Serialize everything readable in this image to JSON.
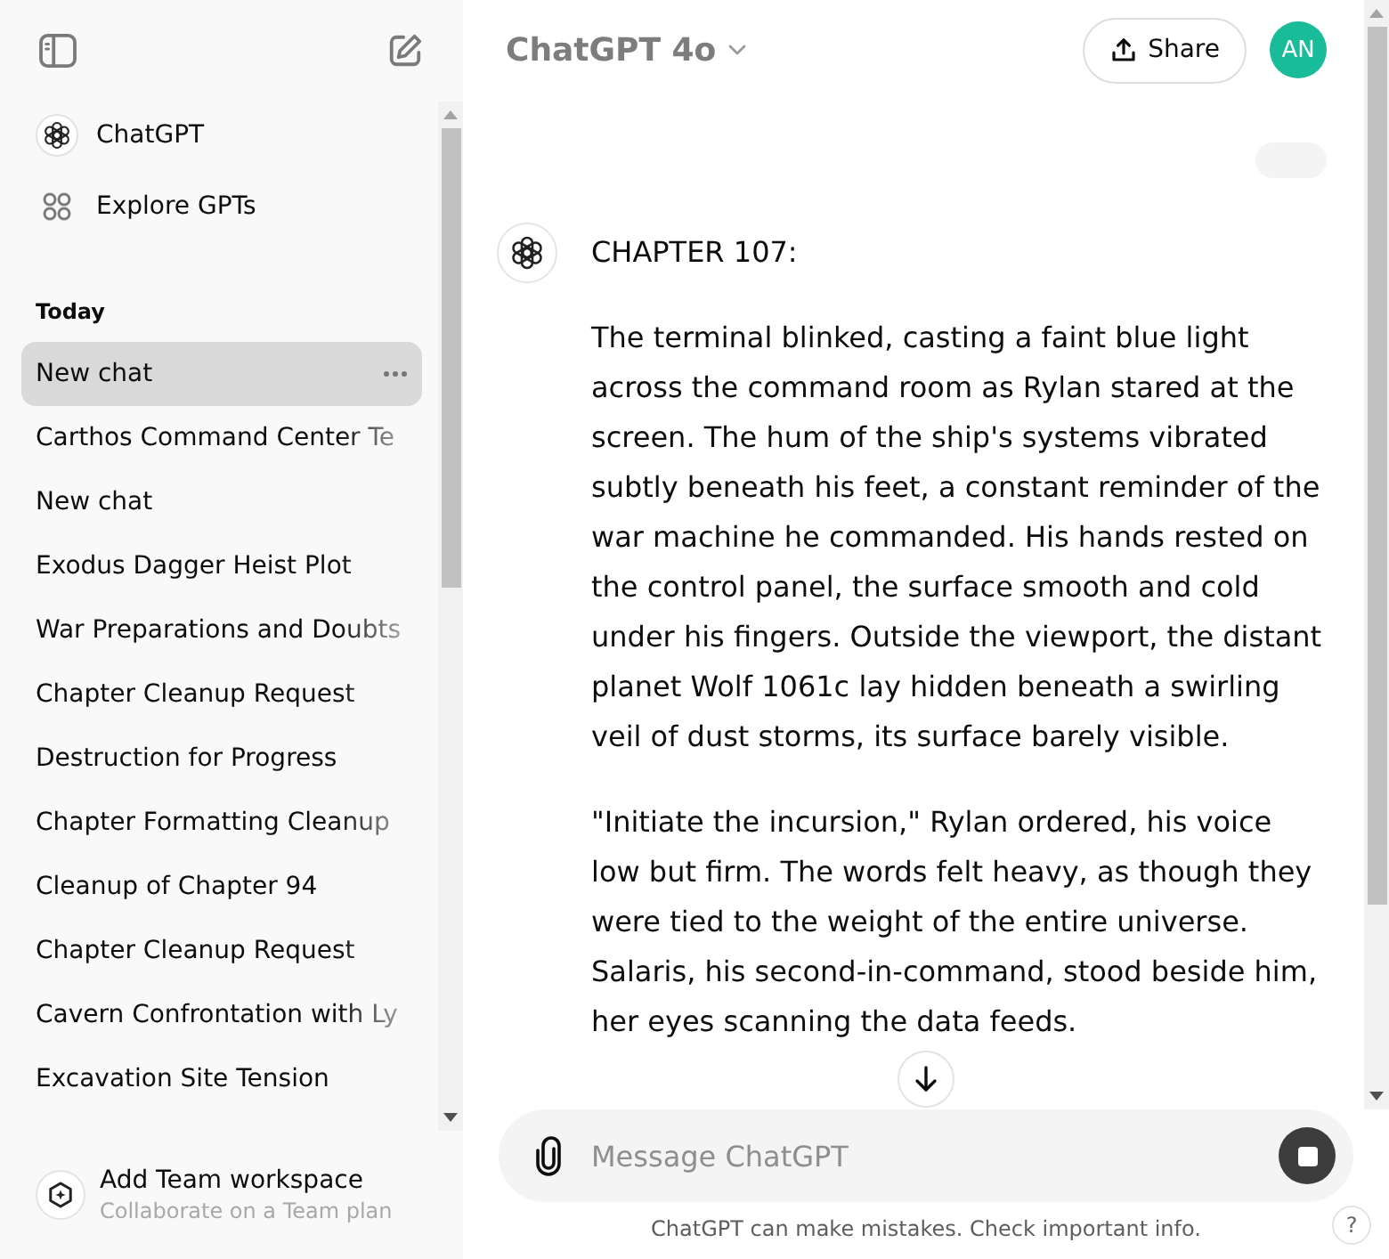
{
  "sidebar": {
    "nav": [
      {
        "kind": "chatgpt",
        "label": "ChatGPT"
      },
      {
        "kind": "explore",
        "label": "Explore GPTs"
      }
    ],
    "history": {
      "heading": "Today",
      "items": [
        {
          "title": "New chat",
          "selected": true
        },
        {
          "title": "Carthos Command Center Te",
          "selected": false
        },
        {
          "title": "New chat",
          "selected": false
        },
        {
          "title": "Exodus Dagger Heist Plot",
          "selected": false
        },
        {
          "title": "War Preparations and Doubts",
          "selected": false
        },
        {
          "title": "Chapter Cleanup Request",
          "selected": false
        },
        {
          "title": "Destruction for Progress",
          "selected": false
        },
        {
          "title": "Chapter Formatting Cleanup",
          "selected": false
        },
        {
          "title": "Cleanup of Chapter 94",
          "selected": false
        },
        {
          "title": "Chapter Cleanup Request",
          "selected": false
        },
        {
          "title": "Cavern Confrontation with Ly",
          "selected": false
        },
        {
          "title": "Excavation Site Tension",
          "selected": false
        }
      ]
    },
    "workspace": {
      "title": "Add Team workspace",
      "subtitle": "Collaborate on a Team plan"
    }
  },
  "header": {
    "model": "ChatGPT 4o",
    "share": "Share",
    "avatar": "AN"
  },
  "thread": {
    "messages": [
      {
        "kind": "user"
      },
      {
        "kind": "assistant",
        "paragraphs": [
          "CHAPTER 107:",
          "The terminal blinked, casting a faint blue light across the command room as Rylan stared at the screen. The hum of the ship's systems vibrated subtly beneath his feet, a constant reminder of the war machine he commanded. His hands rested on the control panel, the surface smooth and cold under his fingers. Outside the viewport, the distant planet Wolf 1061c lay hidden beneath a swirling veil of dust storms, its surface barely visible.",
          "\"Initiate the incursion,\" Rylan ordered, his voice low but firm. The words felt heavy, as though they were tied to the weight of the entire universe. Salaris, his second-in-command, stood beside him, her eyes scanning the data feeds."
        ]
      }
    ]
  },
  "composer": {
    "placeholder": "Message ChatGPT"
  },
  "disclaimer": "ChatGPT can make mistakes. Check important info.",
  "help": "?"
}
